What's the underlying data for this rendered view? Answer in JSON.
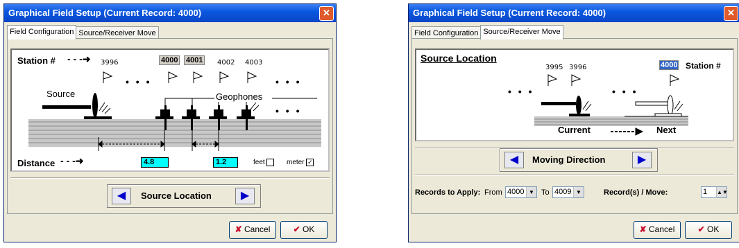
{
  "left": {
    "title": "Graphical Field Setup (Current Record: 4000)",
    "tabs": [
      "Field Configuration",
      "Source/Receiver Move"
    ],
    "station_label": "Station #",
    "stations": [
      "3996",
      "4000",
      "4001",
      "4002",
      "4003"
    ],
    "dots": "• • •",
    "source_label": "Source",
    "geophones_label": "Geophones",
    "distance_label": "Distance",
    "distance1": "4.8",
    "distance2": "1.2",
    "unit_feet": "feet",
    "unit_meter": "meter",
    "feet_checked": false,
    "meter_checked": true,
    "nav_label": "Source Location",
    "cancel": "Cancel",
    "ok": "OK"
  },
  "right": {
    "title": "Graphical Field Setup (Current Record: 4000)",
    "tabs": [
      "Field Configuration",
      "Source/Receiver Move"
    ],
    "source_location": "Source Location",
    "stations": [
      "3995",
      "3996"
    ],
    "current_station": "4000",
    "station_label": "Station #",
    "dots": "• • •",
    "current_label": "Current",
    "next_label": "Next",
    "nav_label": "Moving Direction",
    "records_label": "Records to Apply:",
    "from_label": "From",
    "from_value": "4000",
    "to_label": "To",
    "to_value": "4009",
    "per_move_label": "Record(s) / Move:",
    "per_move_value": "1",
    "cancel": "Cancel",
    "ok": "OK"
  },
  "colors": {
    "titlebar": "#0a58e0",
    "cyan": "#00ffff",
    "arrow_blue": "#0000cc",
    "arrow_red": "#cc0000"
  }
}
